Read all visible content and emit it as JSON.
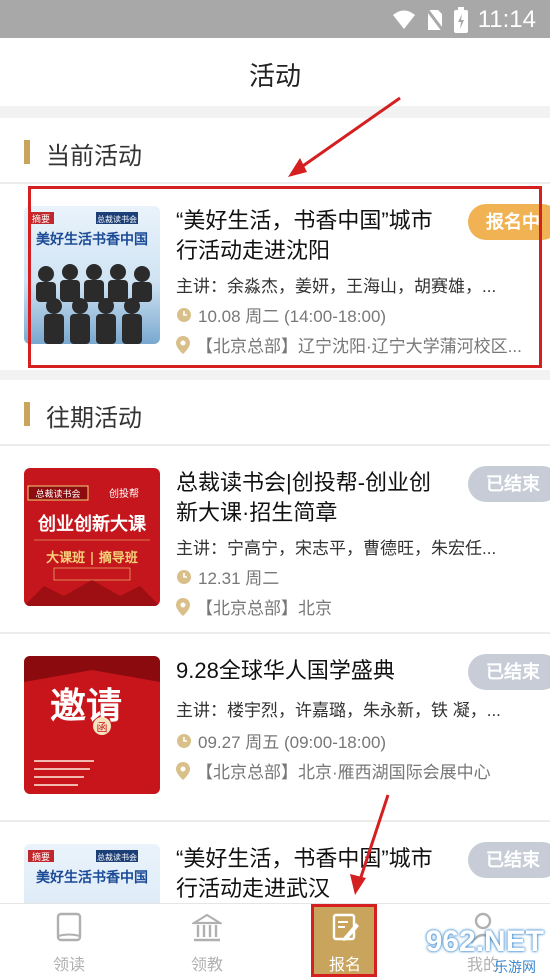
{
  "status": {
    "time": "11:14"
  },
  "header": {
    "title": "活动"
  },
  "current_section": {
    "label": "当前活动"
  },
  "past_section": {
    "label": "往期活动"
  },
  "current_events": [
    {
      "title": "“美好生活，书香中国”城市行活动走进沈阳",
      "speakers": "主讲：余淼杰，姜妍，王海山，胡赛雄，...",
      "time": "10.08 周二 (14:00-18:00)",
      "place": "【北京总部】辽宁沈阳·辽宁大学蒲河校区...",
      "badge": "报名中",
      "thumb_text": "美好生活书香中国",
      "thumb_tag": "总裁读书会",
      "thumb_brand": "摘要"
    }
  ],
  "past_events": [
    {
      "title": "总裁读书会|创投帮-创业创新大课·招生简章",
      "speakers": "主讲：宁高宁，宋志平，曹德旺，朱宏任...",
      "time": "12.31 周二",
      "place": "【北京总部】北京",
      "badge": "已结束",
      "thumb_text": "创业创新大课",
      "thumb_sub": "大课班 | 摘导班",
      "thumb_tag": "总裁读书会",
      "thumb_brand": "创投帮"
    },
    {
      "title": "9.28全球华人国学盛典",
      "speakers": "主讲：楼宇烈，许嘉璐，朱永新，铁 凝，...",
      "time": "09.27 周五 (09:00-18:00)",
      "place": "【北京总部】北京·雁西湖国际会展中心",
      "badge": "已结束",
      "thumb_text": "邀请",
      "thumb_sub": "函"
    },
    {
      "title": "“美好生活，书香中国”城市行活动走进武汉",
      "badge": "已结束",
      "thumb_text": "美好生活书香中国",
      "thumb_tag": "总裁读书会",
      "thumb_brand": "摘要"
    }
  ],
  "tabs": [
    {
      "label": "领读",
      "icon": "book-icon"
    },
    {
      "label": "领教",
      "icon": "institution-icon"
    },
    {
      "label": "报名",
      "icon": "signup-icon"
    },
    {
      "label": "我的",
      "icon": "profile-icon"
    }
  ],
  "watermark": {
    "main": "962.NET",
    "sub": "乐游网"
  },
  "colors": {
    "accent": "#c9a45c",
    "badge_open": "#f0b253",
    "badge_ended": "#c7ccd6",
    "annotation": "#d42020"
  }
}
